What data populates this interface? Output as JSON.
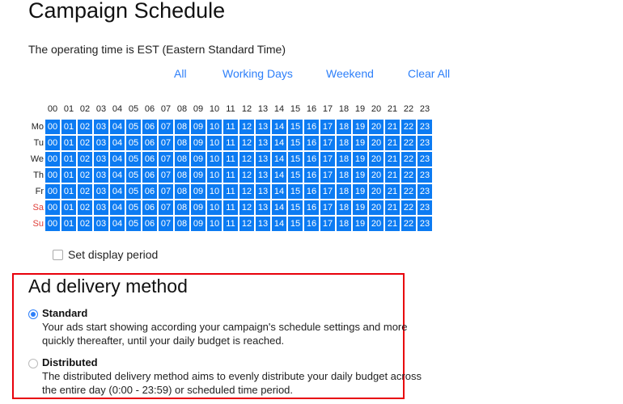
{
  "header": {
    "title": "Campaign Schedule",
    "timezone_text": "The operating time is EST (Eastern Standard Time)"
  },
  "quick_select": {
    "all": "All",
    "working_days": "Working Days",
    "weekend": "Weekend",
    "clear_all": "Clear All"
  },
  "schedule": {
    "hours": [
      "00",
      "01",
      "02",
      "03",
      "04",
      "05",
      "06",
      "07",
      "08",
      "09",
      "10",
      "11",
      "12",
      "13",
      "14",
      "15",
      "16",
      "17",
      "18",
      "19",
      "20",
      "21",
      "22",
      "23"
    ],
    "days": [
      {
        "label": "Mo",
        "weekend": false,
        "selected_hours": "all"
      },
      {
        "label": "Tu",
        "weekend": false,
        "selected_hours": "all"
      },
      {
        "label": "We",
        "weekend": false,
        "selected_hours": "all"
      },
      {
        "label": "Th",
        "weekend": false,
        "selected_hours": "all"
      },
      {
        "label": "Fr",
        "weekend": false,
        "selected_hours": "all"
      },
      {
        "label": "Sa",
        "weekend": true,
        "selected_hours": "all"
      },
      {
        "label": "Su",
        "weekend": true,
        "selected_hours": "all"
      }
    ],
    "selected_color": "#0c7bf2",
    "weekend_label_color": "#e0403a"
  },
  "display_period": {
    "label": "Set display period",
    "checked": false
  },
  "delivery": {
    "title": "Ad delivery method",
    "highlight_color": "#e8000b",
    "options": [
      {
        "label": "Standard",
        "checked": true,
        "description": "Your ads start showing according your campaign's schedule settings and more quickly thereafter, until your daily budget is reached."
      },
      {
        "label": "Distributed",
        "checked": false,
        "description": "The distributed delivery method aims to evenly distribute your daily budget across the entire day (0:00 - 23:59) or scheduled time period."
      }
    ]
  }
}
